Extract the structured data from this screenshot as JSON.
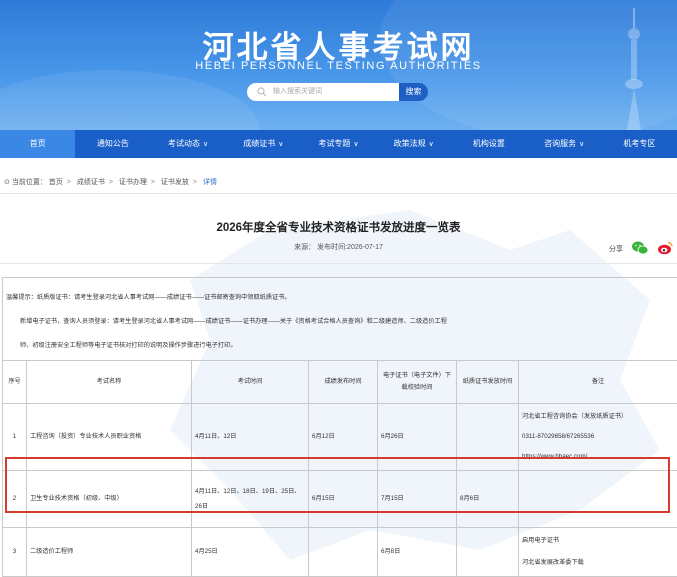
{
  "site": {
    "title": "河北省人事考试网",
    "subtitle": "HEBEI PERSONNEL TESTING AUTHORITIES",
    "search_placeholder": "输入搜索关键词",
    "search_button": "搜索"
  },
  "nav": [
    {
      "label": "首页",
      "chevron": false,
      "active": true
    },
    {
      "label": "通知公告",
      "chevron": false
    },
    {
      "label": "考试动态",
      "chevron": true
    },
    {
      "label": "成绩证书",
      "chevron": true
    },
    {
      "label": "考试专题",
      "chevron": true
    },
    {
      "label": "政策法规",
      "chevron": true
    },
    {
      "label": "机构设置",
      "chevron": false
    },
    {
      "label": "咨询服务",
      "chevron": true
    },
    {
      "label": "机考专区",
      "chevron": false
    }
  ],
  "breadcrumb": {
    "prefix": "当前位置：",
    "items": [
      "首页",
      "成绩证书",
      "证书办理",
      "证书发放"
    ],
    "current": "详情"
  },
  "article": {
    "title": "2026年度全省专业技术资格证书发放进度一览表",
    "source_label": "来源：",
    "date_label": "发布时间:",
    "date": "2026-07-17",
    "share_label": "分享"
  },
  "table": {
    "intro": [
      "温馨提示：纸质版证书：请考生登录河北省人事考试网——成绩证书——证书邮寄查询中领取纸质证书。",
      "新增电子证书，查询人员须登录：请考生登录河北省人事考试网——成绩证书——证书办理——关于《资格考试合格人员查询》和二级建造师、二级造价工程",
      "师、初级注册安全工程师等电子证书核对打印的说明及操作步骤进行电子打印。"
    ],
    "headers": [
      "序号",
      "考试名称",
      "考试时间",
      "成绩发布时间",
      "电子证书（电子文件）下载校验时间",
      "纸质证书发放时间",
      "备注"
    ],
    "rows": [
      {
        "no": "1",
        "name": "工程咨询（投资）专业技术人员职业资格",
        "exam_date": "4月11日、12日",
        "score_date": "6月12日",
        "ecert_date": "6月26日",
        "paper_date": "",
        "remarks": [
          "河北省工程咨询协会（发放纸质证书）",
          "0311-87029658/67265536",
          "https://www.hbaec.com/"
        ]
      },
      {
        "no": "2",
        "name": "卫生专业技术资格（初级、中级）",
        "exam_date": "4月11日、12日、18日、19日、25日、26日",
        "score_date": "6月15日",
        "ecert_date": "7月15日",
        "paper_date": "8月6日",
        "remarks": []
      },
      {
        "no": "3",
        "name": "二级造价工程师",
        "exam_date": "4月25日",
        "score_date": "",
        "ecert_date": "6月8日",
        "paper_date": "",
        "remarks": [
          "启用电子证书",
          "河北省发展改革委下载"
        ]
      }
    ]
  },
  "colors": {
    "header_blue": "#2e7bd8",
    "nav_blue": "#1a5fc7",
    "nav_active": "#3b87e6",
    "highlight_red": "#d43b2c",
    "link_blue": "#2d6bc7"
  }
}
